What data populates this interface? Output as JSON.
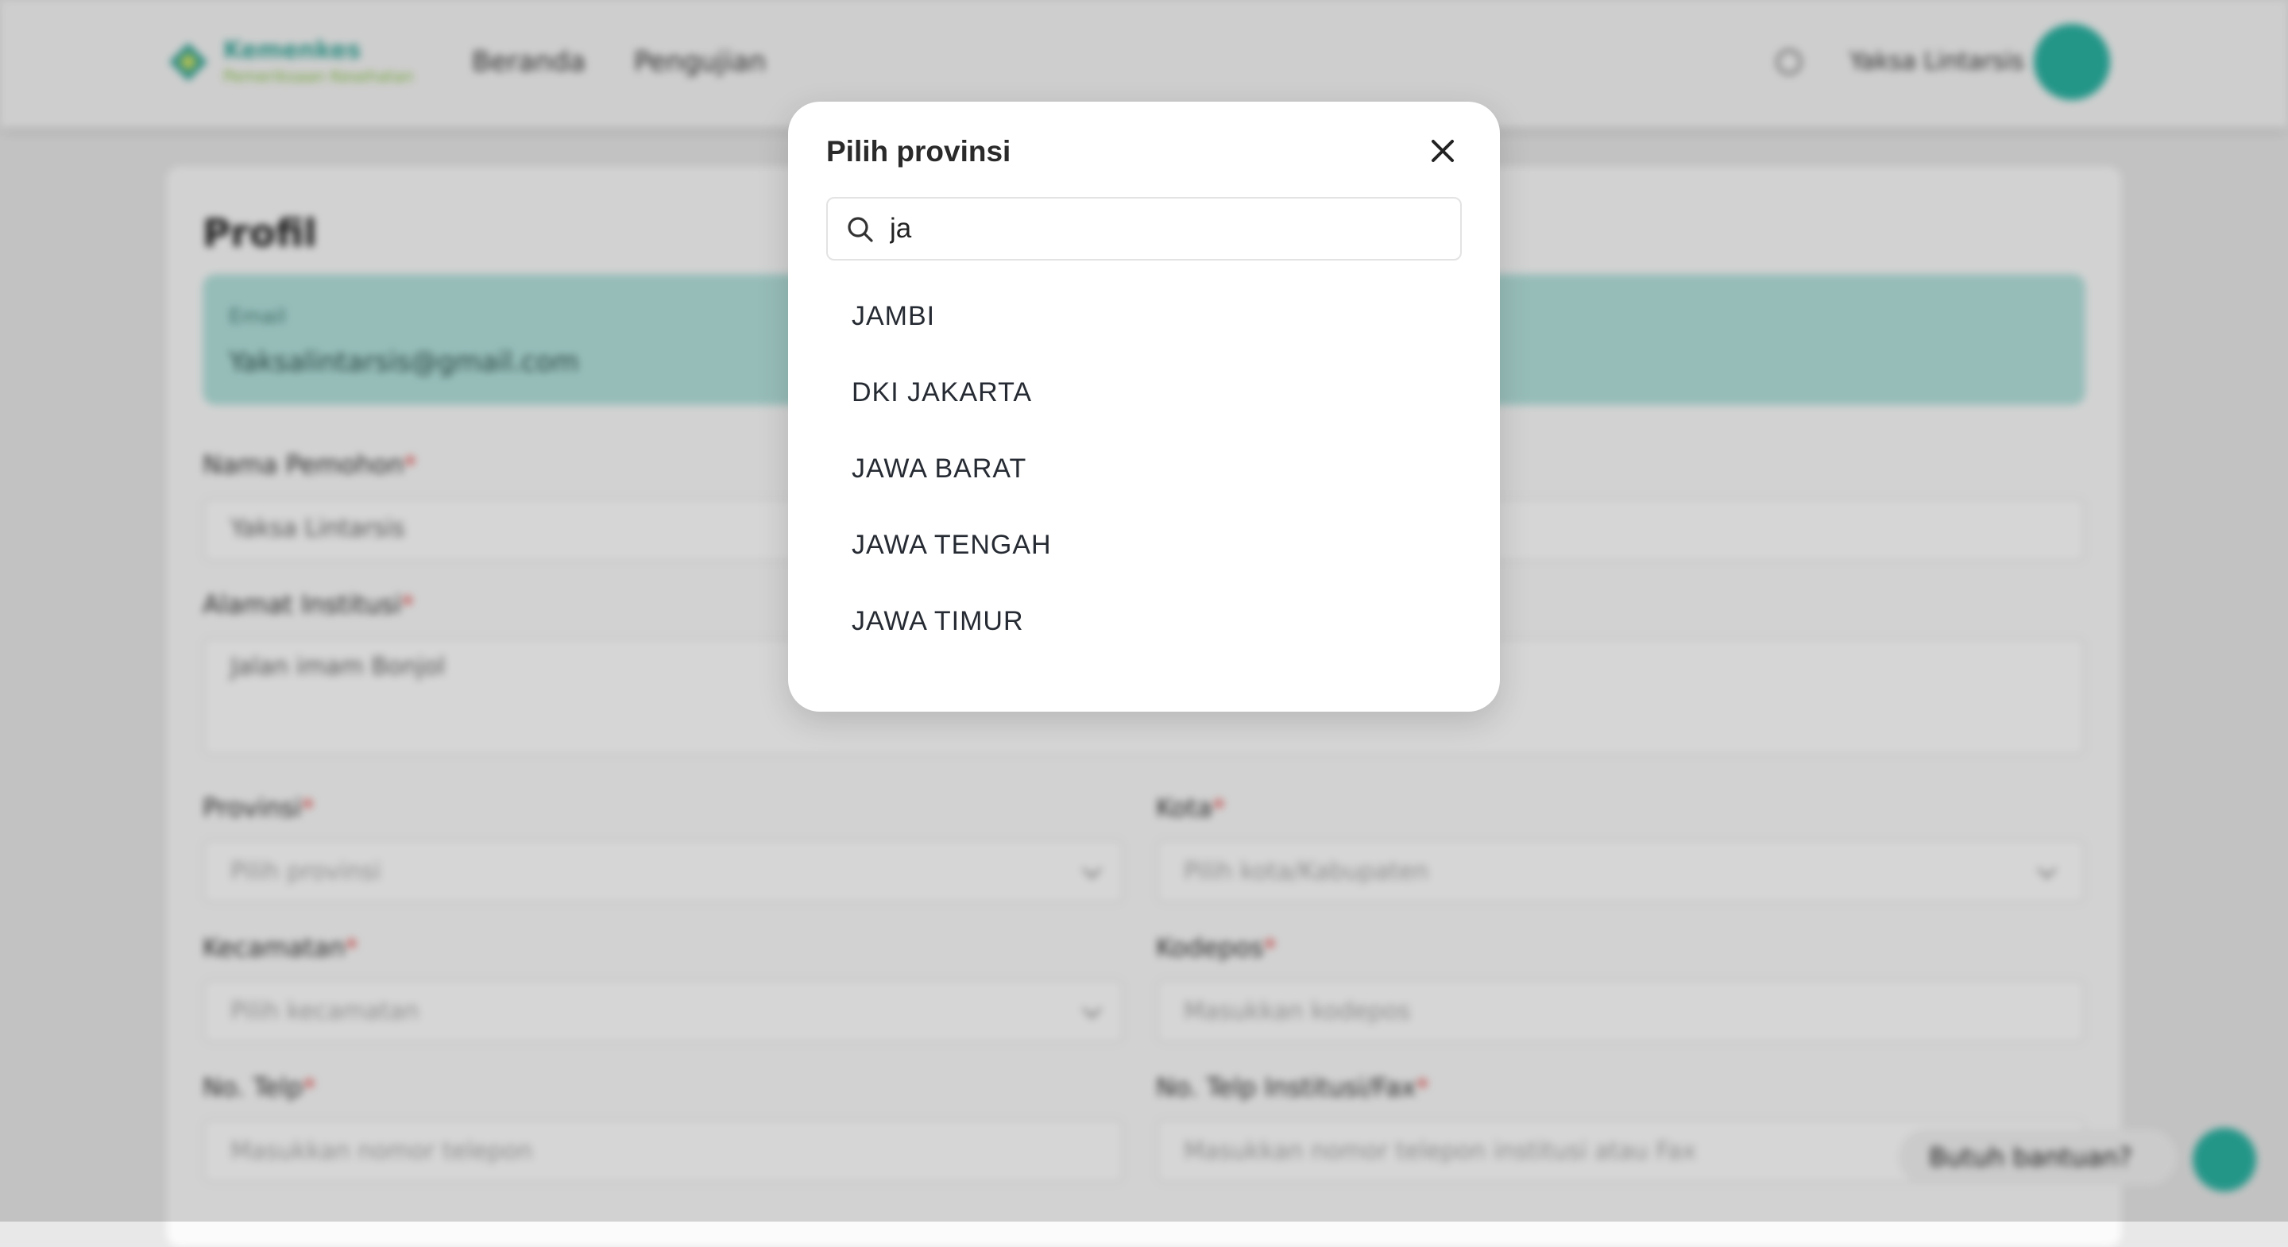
{
  "background": {
    "logo": {
      "line1": "Kemenkes",
      "line2": "Pemeriksaan Kesehatan"
    },
    "nav": [
      "Beranda",
      "Pengujian"
    ],
    "user_name": "Yaksa Lintarsis",
    "page_title": "Profil",
    "email": {
      "label": "Email",
      "value": "Yaksalintarsis@gmail.com"
    },
    "fields": {
      "nama_pemohon": {
        "label": "Nama Pemohon",
        "value": "Yaksa Lintarsis"
      },
      "alamat_institusi": {
        "label": "Alamat Institusi",
        "value": "Jalan imam Bonjol"
      },
      "provinsi": {
        "label": "Provinsi",
        "placeholder": "Pilih provinsi"
      },
      "kota": {
        "label": "Kota",
        "placeholder": "Pilih kota/Kabupaten"
      },
      "kecamatan": {
        "label": "Kecamatan",
        "placeholder": "Pilih kecamatan"
      },
      "kodepos": {
        "label": "Kodepos",
        "placeholder": "Masukkan kodepos"
      },
      "no_telp": {
        "label": "No. Telp",
        "placeholder": "Masukkan nomor telepon"
      },
      "no_telp_institusi": {
        "label": "No. Telp Institusi/Fax",
        "placeholder": "Masukkan nomor telepon institusi atau Fax"
      }
    },
    "required_mark": "*",
    "help_text": "Butuh bantuan?"
  },
  "modal": {
    "title": "Pilih provinsi",
    "search": {
      "value": "ja"
    },
    "options": [
      "JAMBI",
      "DKI JAKARTA",
      "JAWA BARAT",
      "JAWA TENGAH",
      "JAWA TIMUR"
    ]
  }
}
